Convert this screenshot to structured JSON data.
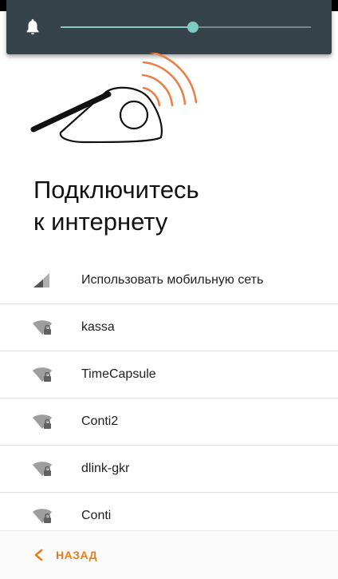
{
  "volume": {
    "icon": "bell-icon",
    "level": 0.53,
    "colors": {
      "panel": "#37434a",
      "accent": "#80cbc4",
      "track": "#78868d"
    }
  },
  "page": {
    "title_line1": "Подключитесь",
    "title_line2": "к интернету",
    "accent_color": "#e67e22"
  },
  "networks": [
    {
      "label": "Использовать мобильную сеть",
      "icon": "cellular-signal-icon"
    },
    {
      "label": "kassa",
      "icon": "wifi-lock-icon"
    },
    {
      "label": "TimeCapsule",
      "icon": "wifi-lock-icon"
    },
    {
      "label": "Conti2",
      "icon": "wifi-lock-icon"
    },
    {
      "label": "dlink-gkr",
      "icon": "wifi-lock-icon"
    },
    {
      "label": "Conti",
      "icon": "wifi-lock-icon"
    }
  ],
  "footer": {
    "back_label": "НАЗАД",
    "back_icon": "chevron-left-icon"
  }
}
